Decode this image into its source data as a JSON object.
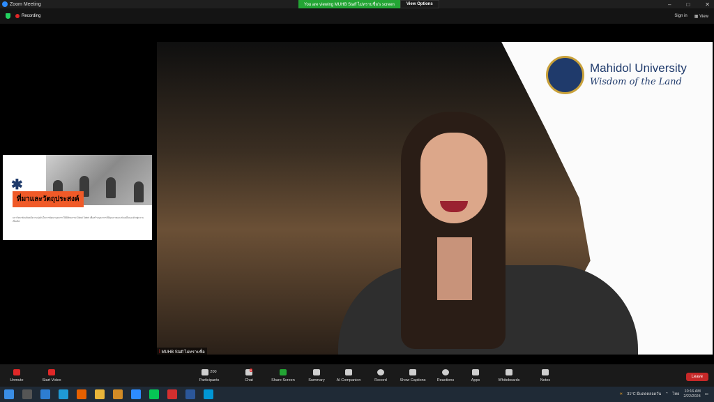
{
  "window": {
    "title": "Zoom Meeting"
  },
  "share_banner": {
    "message": "You are viewing MUHB Staff ไม่ทราบชื่อ's screen",
    "view_options": "View Options"
  },
  "status": {
    "recording": "Recording"
  },
  "top_right": {
    "sign_in": "Sign in",
    "view": "View"
  },
  "slide_thumb": {
    "heading": "ที่มาและวัตถุประสงค์",
    "paragraph": "มหาวิทยาลัยมหิดลมีความมุ่งมั่นในการพัฒนาบุคลากรให้มีศักยภาพ Global Talent เพื่อสร้างบุคลากรที่มีคุณภาพและขับเคลื่อนองค์กรสู่ความเป็นเลิศ"
  },
  "main_slide": {
    "university_name": "Mahidol University",
    "tagline": "Wisdom of the Land"
  },
  "participant_name": "MUHB Staff ไม่ทราบชื่อ",
  "toolbar": {
    "unmute": "Unmute",
    "start_video": "Start Video",
    "participants": "Participants",
    "participant_count": "200",
    "chat": "Chat",
    "chat_badge": "8",
    "share_screen": "Share Screen",
    "summary": "Summary",
    "ai_companion": "AI Companion",
    "record": "Record",
    "show_captions": "Show Captions",
    "reactions": "Reactions",
    "apps": "Apps",
    "whiteboards": "Whiteboards",
    "notes": "Notes",
    "leave": "Leave"
  },
  "taskbar": {
    "weather": "31°C  มีแดดตลอดวัน",
    "language": "ไทย",
    "time": "10:16 AM",
    "date": "2/22/2024"
  }
}
